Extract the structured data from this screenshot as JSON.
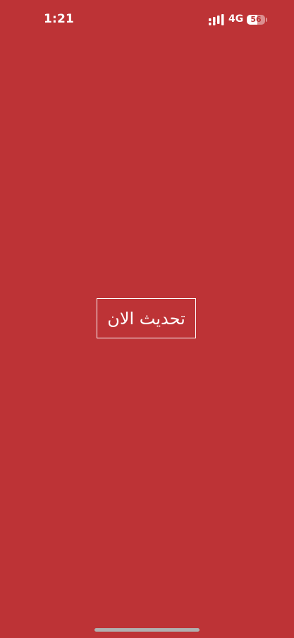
{
  "status_bar": {
    "time": "1:21",
    "network": "4G",
    "battery_level": "56",
    "battery_fraction": 0.56,
    "signal_bars": 4
  },
  "main": {
    "refresh_button_label": "تحديث الان"
  },
  "colors": {
    "background": "#bd3336",
    "foreground": "#ffffff",
    "home_indicator": "#b0b0b0"
  }
}
